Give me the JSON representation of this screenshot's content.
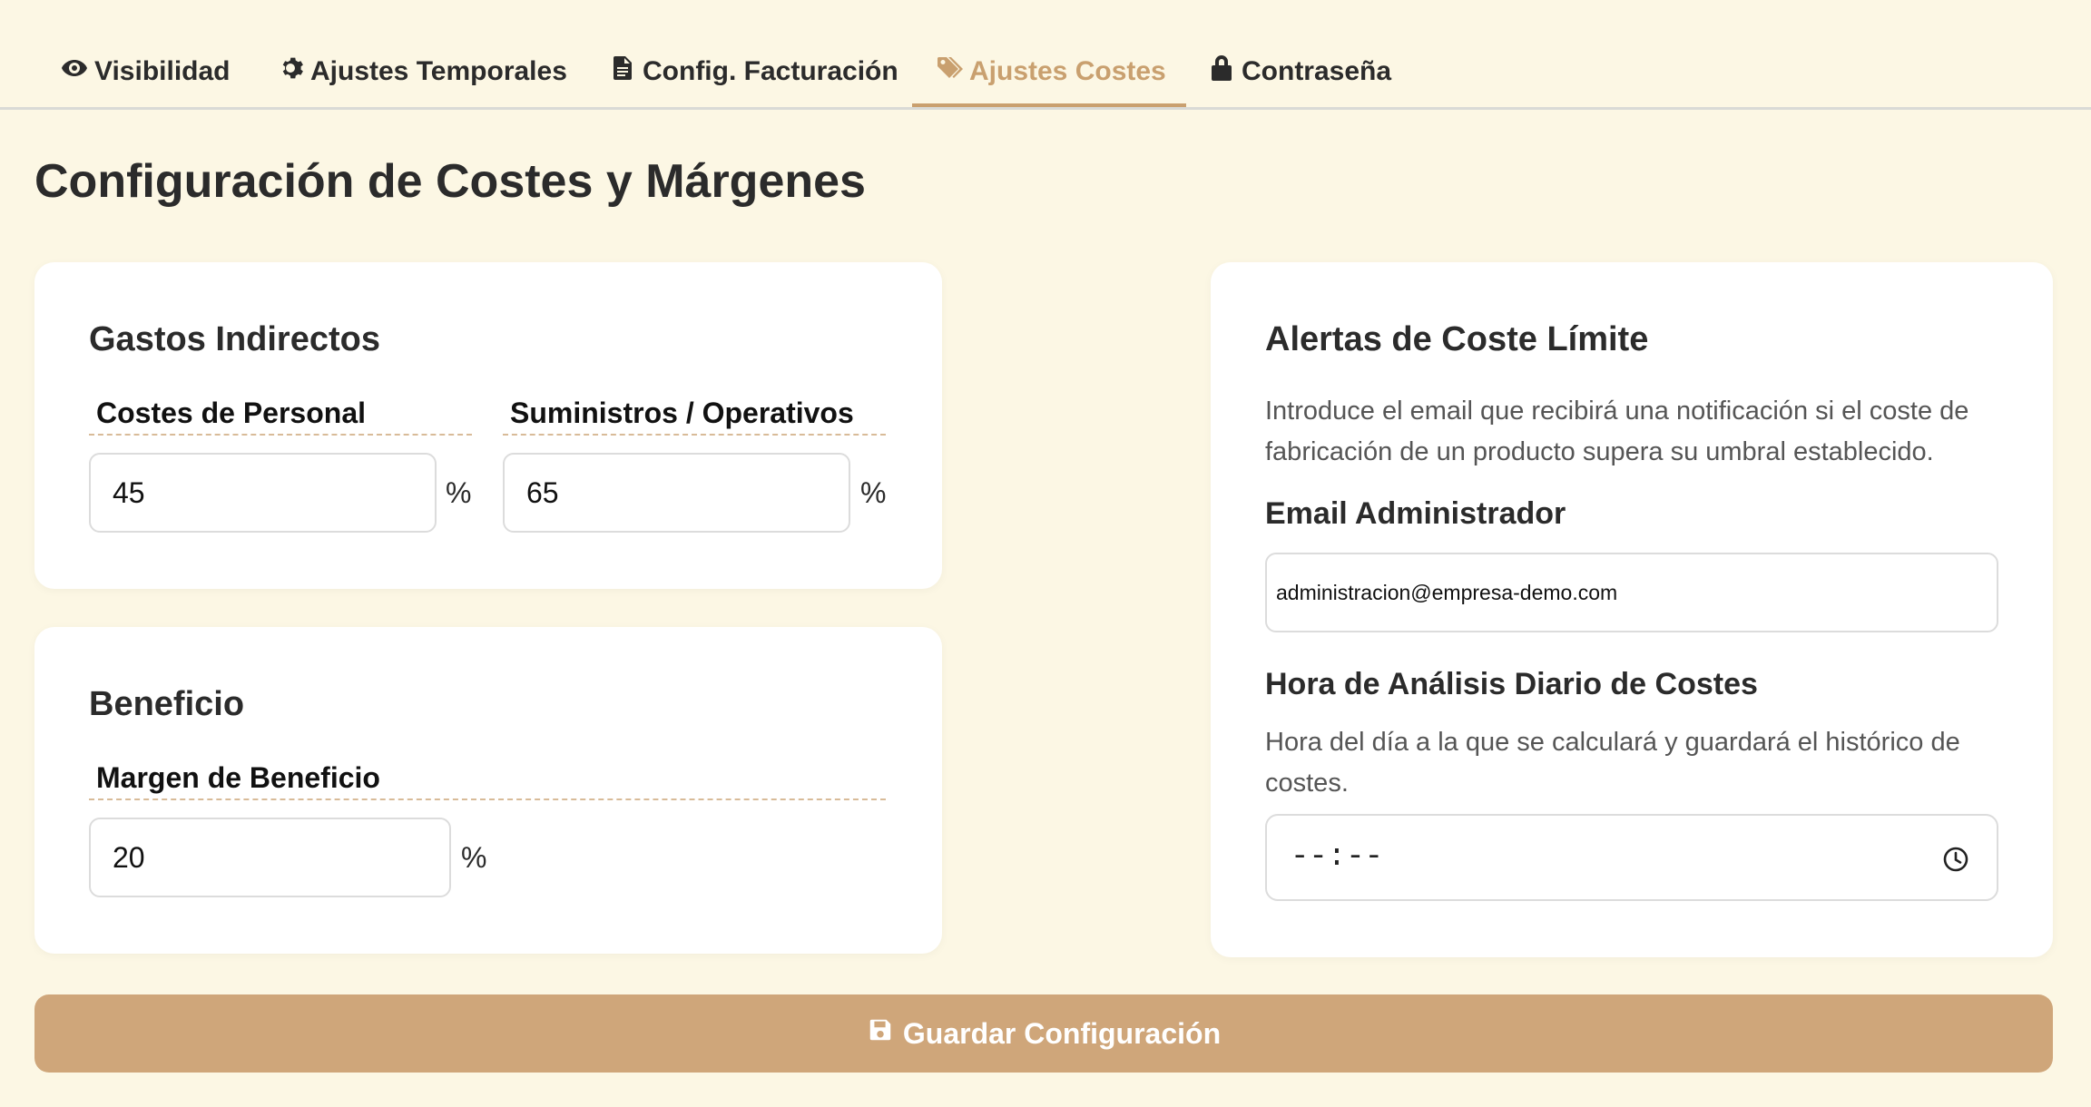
{
  "tabs": [
    {
      "label": "Visibilidad",
      "icon": "eye-icon"
    },
    {
      "label": "Ajustes Temporales",
      "icon": "gear-icon"
    },
    {
      "label": "Config. Facturación",
      "icon": "file-icon"
    },
    {
      "label": "Ajustes Costes",
      "icon": "tags-icon",
      "active": true
    },
    {
      "label": "Contraseña",
      "icon": "lock-icon"
    }
  ],
  "page_title": "Configuración de Costes y Márgenes",
  "indirect": {
    "title": "Gastos Indirectos",
    "personal_label": "Costes de Personal",
    "personal_value": "45",
    "supplies_label": "Suministros / Operativos",
    "supplies_value": "65",
    "unit": "%"
  },
  "profit": {
    "title": "Beneficio",
    "margin_label": "Margen de Beneficio",
    "margin_value": "20",
    "unit": "%"
  },
  "alerts": {
    "title": "Alertas de Coste Límite",
    "description": "Introduce el email que recibirá una notificación si el coste de fabricación de un producto supera su umbral establecido.",
    "email_label": "Email Administrador",
    "email_value": "administracion@empresa-demo.com",
    "time_label": "Hora de Análisis Diario de Costes",
    "time_description": "Hora del día a la que se calculará y guardará el histórico de costes.",
    "time_value": "--:--"
  },
  "save_button": "Guardar Configuración",
  "colors": {
    "background": "#fcf7e4",
    "accent": "#c9a06f",
    "button": "#cfa67a"
  }
}
